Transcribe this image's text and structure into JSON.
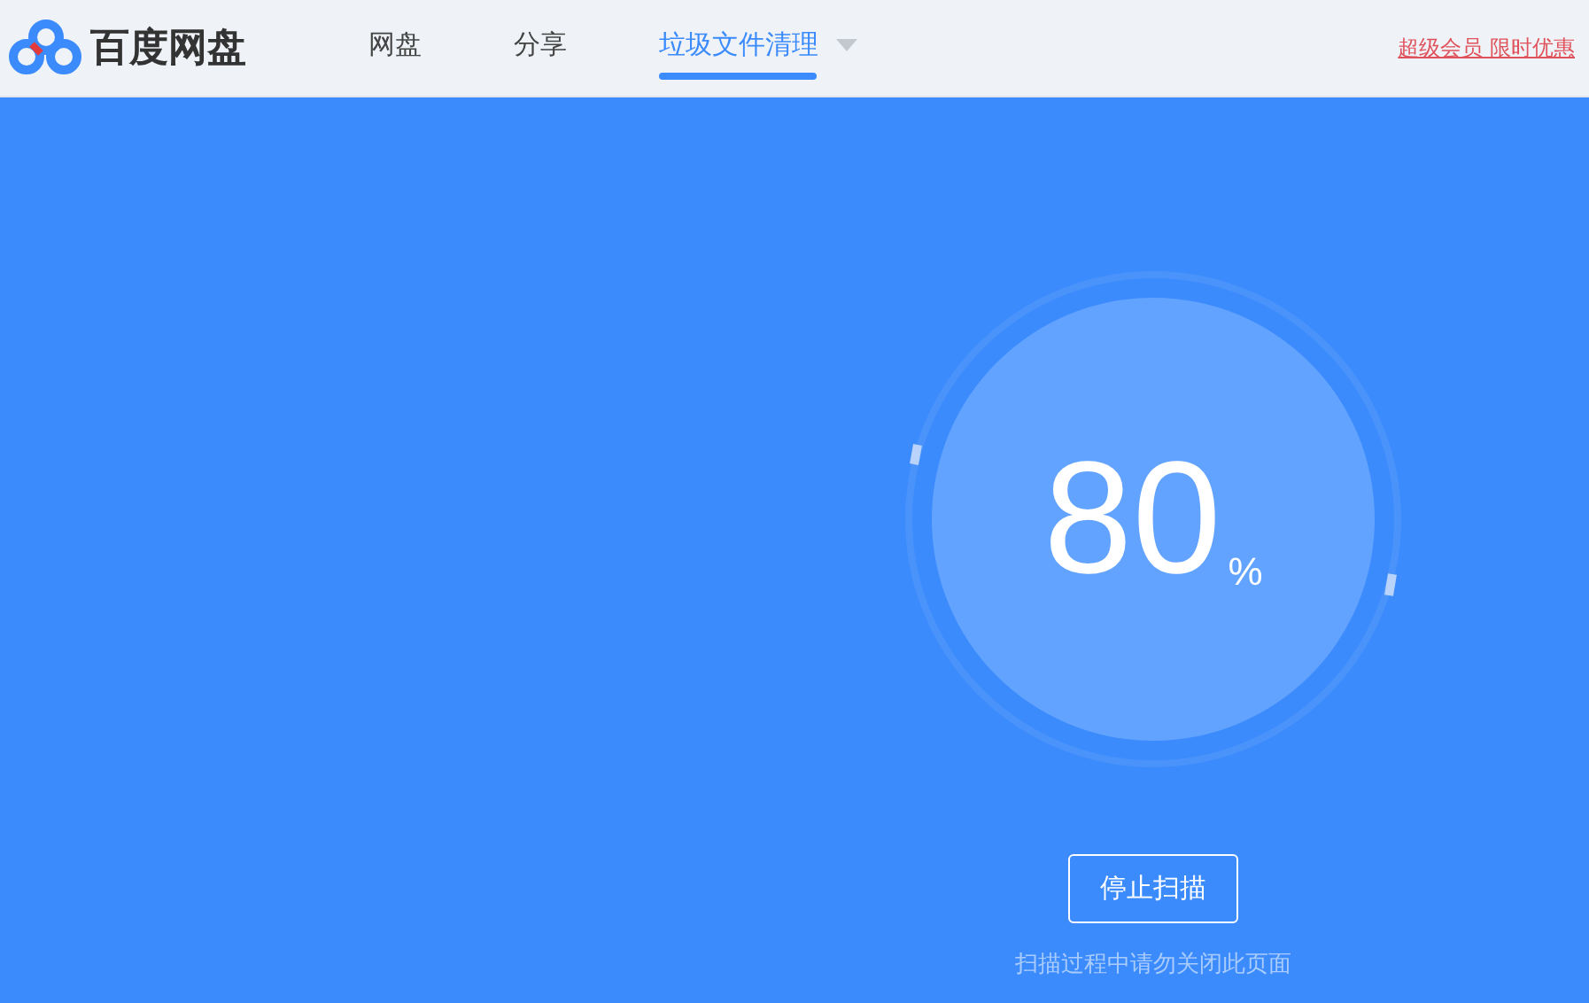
{
  "header": {
    "brand": "百度网盘",
    "tabs": [
      {
        "label": "网盘",
        "selected": false,
        "dropdown": false
      },
      {
        "label": "分享",
        "selected": false,
        "dropdown": false
      },
      {
        "label": "垃圾文件清理",
        "selected": true,
        "dropdown": true
      }
    ],
    "promo_link": "超级会员 限时优惠"
  },
  "scan": {
    "percent": "80",
    "unit": "%",
    "stop_button": "停止扫描",
    "hint": "扫描过程中请勿关闭此页面"
  }
}
